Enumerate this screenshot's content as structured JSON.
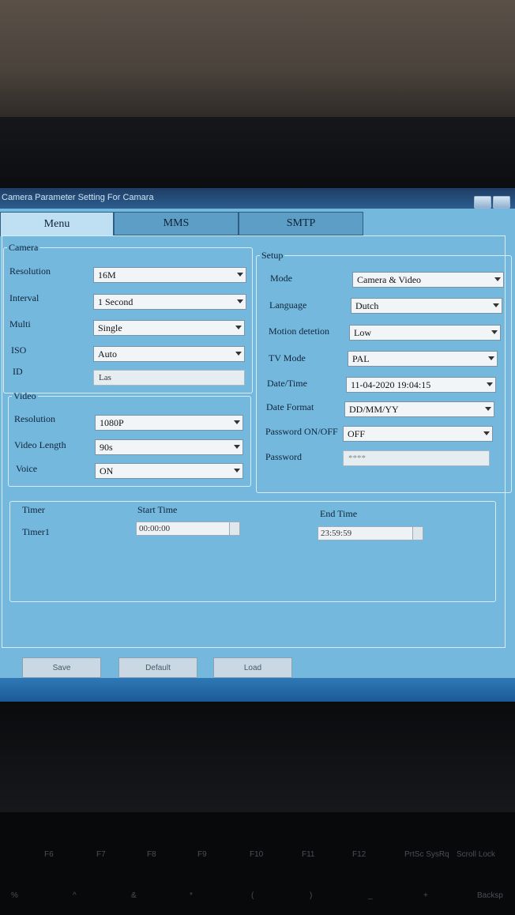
{
  "window": {
    "title": "Camera Parameter Setting For Camara"
  },
  "tabs": [
    {
      "label": "Menu"
    },
    {
      "label": "MMS"
    },
    {
      "label": "SMTP"
    }
  ],
  "camera": {
    "legend": "Camera",
    "resolution_label": "Resolution",
    "resolution_value": "16M",
    "interval_label": "Interval",
    "interval_value": "1 Second",
    "multi_label": "Multi",
    "multi_value": "Single",
    "iso_label": "ISO",
    "iso_value": "Auto",
    "id_label": "ID",
    "id_value": "Las"
  },
  "video": {
    "legend": "Video",
    "resolution_label": "Resolution",
    "resolution_value": "1080P",
    "length_label": "Video Length",
    "length_value": "90s",
    "voice_label": "Voice",
    "voice_value": "ON"
  },
  "setup": {
    "legend": "Setup",
    "mode_label": "Mode",
    "mode_value": "Camera & Video",
    "language_label": "Language",
    "language_value": "Dutch",
    "motion_label": "Motion detetion",
    "motion_value": "Low",
    "tvmode_label": "TV Mode",
    "tvmode_value": "PAL",
    "datetime_label": "Date/Time",
    "datetime_value": "11-04-2020 19:04:15",
    "dateformat_label": "Date Format",
    "dateformat_value": "DD/MM/YY",
    "password_onoff_label": "Password ON/OFF",
    "password_onoff_value": "OFF",
    "password_label": "Password",
    "password_value": "****"
  },
  "timer": {
    "timer_header": "Timer",
    "start_header": "Start Time",
    "end_header": "End Time",
    "row_label": "Timer1",
    "start_value": "00:00:00",
    "end_value": "23:59:59"
  },
  "buttons": {
    "save": "Save",
    "default": "Default",
    "load": "Load"
  },
  "keyboard": {
    "fkeys": [
      "F6",
      "F7",
      "F8",
      "F9",
      "F10",
      "F11",
      "F12",
      "PrtSc SysRq",
      "Scroll Lock"
    ],
    "symbols": [
      "%",
      "^",
      "&",
      "*",
      "(",
      ")",
      "_",
      "+",
      "Backsp"
    ]
  },
  "colors": {
    "screen": "#74b8de",
    "titlebar": "#1d3d64",
    "taskbar": "#1b5a96"
  }
}
